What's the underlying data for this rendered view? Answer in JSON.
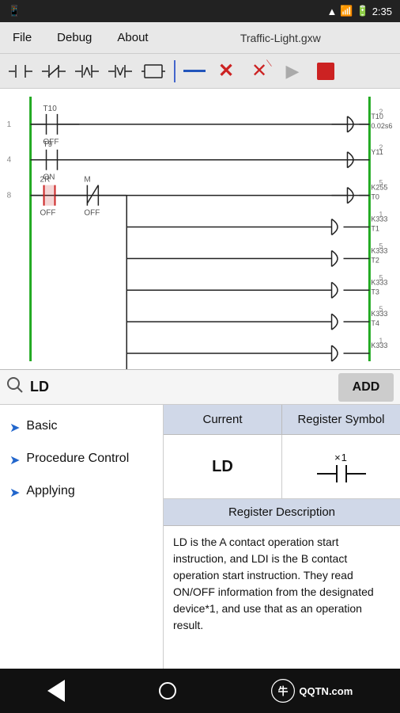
{
  "status_bar": {
    "time": "2:35",
    "icons": [
      "wifi",
      "signal",
      "battery"
    ]
  },
  "menu_bar": {
    "items": [
      "File",
      "Debug",
      "About"
    ],
    "file_title": "Traffic-Light.gxw"
  },
  "toolbar": {
    "buttons": [
      {
        "name": "no-contact",
        "symbol": "⊣⊢"
      },
      {
        "name": "nc-contact",
        "symbol": "⊣/⊢"
      },
      {
        "name": "pos-contact",
        "symbol": "⊣↑⊢"
      },
      {
        "name": "neg-contact",
        "symbol": "⊣↓⊢"
      },
      {
        "name": "function",
        "symbol": "⟦⟧"
      },
      {
        "name": "divider",
        "type": "divider"
      },
      {
        "name": "line",
        "type": "line"
      },
      {
        "name": "delete-x",
        "symbol": "✕"
      },
      {
        "name": "delete-red",
        "symbol": "✕"
      },
      {
        "name": "run",
        "symbol": "▶"
      },
      {
        "name": "stop",
        "type": "stop"
      }
    ]
  },
  "search": {
    "value": "LD",
    "placeholder": "LD",
    "add_label": "ADD"
  },
  "nav": {
    "items": [
      {
        "label": "Basic",
        "id": "basic"
      },
      {
        "label": "Procedure Control",
        "id": "procedure-control"
      },
      {
        "label": "Applying",
        "id": "applying"
      }
    ]
  },
  "detail": {
    "col1_header": "Current",
    "col2_header": "Register Symbol",
    "current_value": "LD",
    "symbol_x1": "×1",
    "register_description_header": "Register Description",
    "description": "LD is the A contact operation start instruction, and LDI is the B contact operation start instruction. They read ON/OFF information from the designated device*1, and use that as an operation result."
  },
  "bottom_nav": {
    "logo_text": "QQTN.com"
  }
}
